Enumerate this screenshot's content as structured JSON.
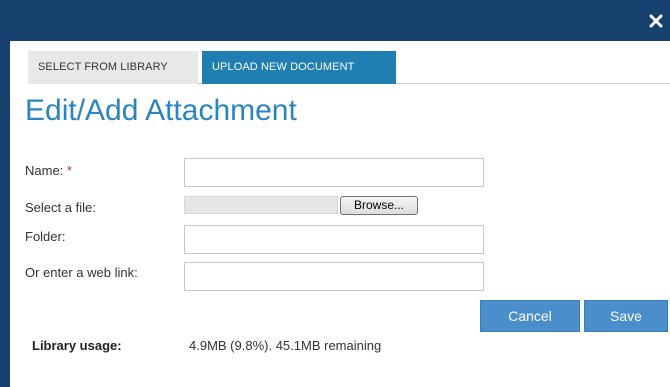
{
  "dialog": {
    "close_icon": "close-icon"
  },
  "tabs": [
    {
      "label": "SELECT FROM LIBRARY",
      "active": false
    },
    {
      "label": "UPLOAD NEW DOCUMENT",
      "active": true
    }
  ],
  "heading": "Edit/Add Attachment",
  "form": {
    "name_label": "Name:",
    "name_required_marker": "*",
    "name_value": "",
    "file_label": "Select a file:",
    "browse_label": "Browse...",
    "folder_label": "Folder:",
    "folder_value": "",
    "weblink_label": "Or enter a web link:",
    "weblink_value": ""
  },
  "actions": {
    "cancel_label": "Cancel",
    "save_label": "Save"
  },
  "usage": {
    "label": "Library usage:",
    "value": "4.9MB (9.8%). 45.1MB remaining"
  },
  "colors": {
    "titlebar": "#15406e",
    "active_tab": "#1f7fb3",
    "heading": "#2a84bf",
    "button": "#4a8fcc",
    "required": "#d22f2f"
  }
}
